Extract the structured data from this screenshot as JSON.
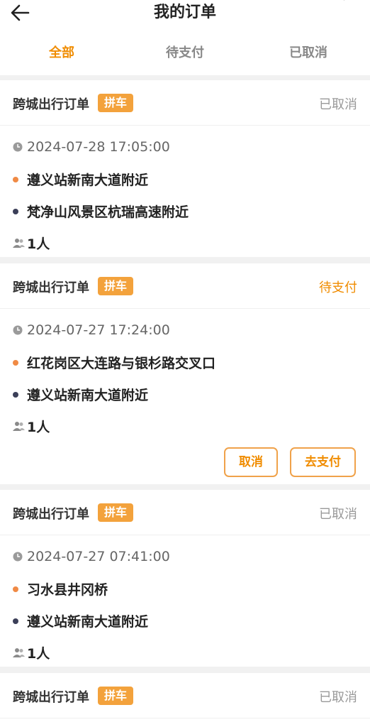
{
  "header": {
    "title": "我的订单",
    "back_icon": "arrow-left-icon"
  },
  "tabs": [
    {
      "label": "全部",
      "active": true
    },
    {
      "label": "待支付",
      "active": false
    },
    {
      "label": "已取消",
      "active": false
    }
  ],
  "colors": {
    "accent": "#f08c00",
    "tag_bg": "#f3a23c",
    "start_dot": "#f08a45",
    "end_dot": "#3b3f58"
  },
  "orders": [
    {
      "type": "跨城出行订单",
      "tag": "拼车",
      "status": "已取消",
      "time": "2024-07-28 17:05:00",
      "start": "遵义站新南大道附近",
      "end": "梵净山风景区杭瑞高速附近",
      "people": "1人"
    },
    {
      "type": "跨城出行订单",
      "tag": "拼车",
      "status": "待支付",
      "time": "2024-07-27 17:24:00",
      "start": "红花岗区大连路与银杉路交叉口",
      "end": "遵义站新南大道附近",
      "people": "1人",
      "actions": {
        "cancel": "取消",
        "pay": "去支付"
      }
    },
    {
      "type": "跨城出行订单",
      "tag": "拼车",
      "status": "已取消",
      "time": "2024-07-27 07:41:00",
      "start": "习水县井冈桥",
      "end": "遵义站新南大道附近",
      "people": "1人"
    },
    {
      "type": "跨城出行订单",
      "tag": "拼车",
      "status": "已取消"
    }
  ]
}
